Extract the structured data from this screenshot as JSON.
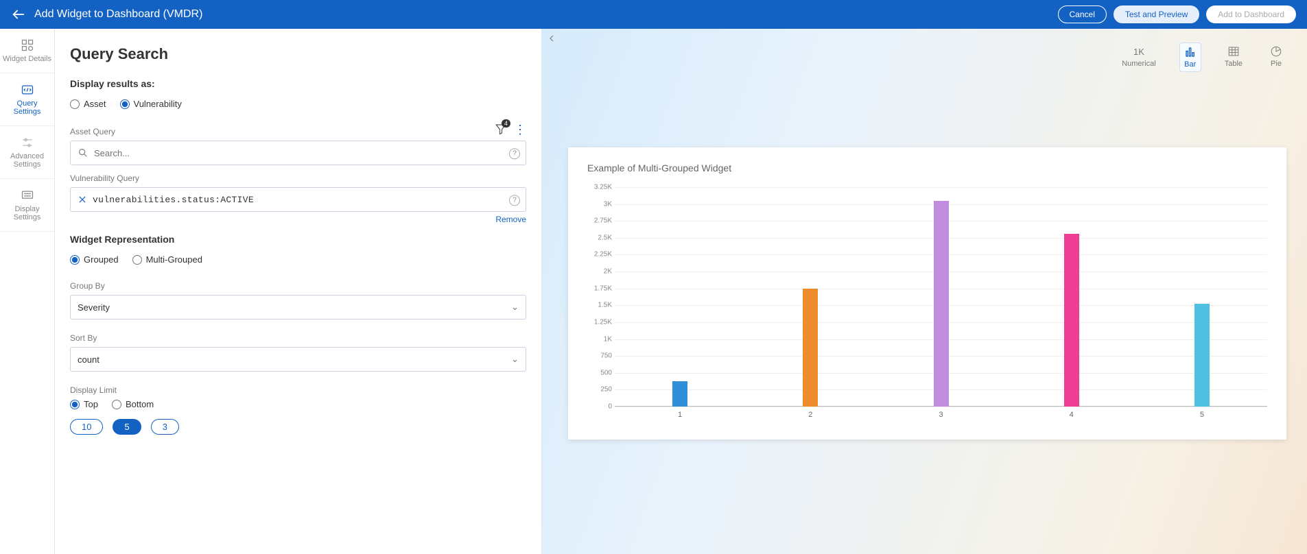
{
  "header": {
    "title": "Add Widget to Dashboard (VMDR)",
    "cancel": "Cancel",
    "test": "Test and Preview",
    "add": "Add to Dashboard"
  },
  "sidebar": [
    {
      "key": "widget-details",
      "label": "Widget Details"
    },
    {
      "key": "query-settings",
      "label": "Query Settings"
    },
    {
      "key": "advanced-settings",
      "label": "Advanced Settings"
    },
    {
      "key": "display-settings",
      "label": "Display Settings"
    }
  ],
  "page_title": "Query Search",
  "display_results_label": "Display results as:",
  "display_results_options": {
    "asset": "Asset",
    "vuln": "Vulnerability"
  },
  "asset_query": {
    "label": "Asset Query",
    "placeholder": "Search...",
    "filter_badge": "4"
  },
  "vuln_query": {
    "label": "Vulnerability Query",
    "value": "vulnerabilities.status:ACTIVE",
    "remove": "Remove"
  },
  "widget_rep": {
    "label": "Widget Representation",
    "options": {
      "grouped": "Grouped",
      "multi": "Multi-Grouped"
    }
  },
  "group_by": {
    "label": "Group By",
    "value": "Severity"
  },
  "sort_by": {
    "label": "Sort By",
    "value": "count"
  },
  "display_limit": {
    "label": "Display Limit",
    "options": {
      "top": "Top",
      "bottom": "Bottom"
    },
    "pills": [
      "10",
      "5",
      "3"
    ],
    "selected": "5"
  },
  "widget_types": [
    {
      "key": "numerical",
      "label": "Numerical",
      "icon": "1K"
    },
    {
      "key": "bar",
      "label": "Bar"
    },
    {
      "key": "table",
      "label": "Table"
    },
    {
      "key": "pie",
      "label": "Pie"
    }
  ],
  "chart_data": {
    "type": "bar",
    "title": "Example of Multi-Grouped Widget",
    "categories": [
      "1",
      "2",
      "3",
      "4",
      "5"
    ],
    "series": [
      {
        "name": "",
        "values": [
          375,
          1750,
          3050,
          2560,
          1520
        ],
        "colors": [
          "#2f8fd8",
          "#ed8c2b",
          "#c18be0",
          "#ef3d94",
          "#4fc0e0"
        ]
      }
    ],
    "ylim": [
      0,
      3250
    ],
    "yticks": [
      0,
      250,
      500,
      750,
      1000,
      1250,
      1500,
      1750,
      2000,
      2250,
      2500,
      2750,
      3000,
      3250
    ],
    "ytick_labels": [
      "0",
      "250",
      "500",
      "750",
      "1K",
      "1.25K",
      "1.5K",
      "1.75K",
      "2K",
      "2.25K",
      "2.5K",
      "2.75K",
      "3K",
      "3.25K"
    ],
    "xlabel": "",
    "ylabel": ""
  }
}
